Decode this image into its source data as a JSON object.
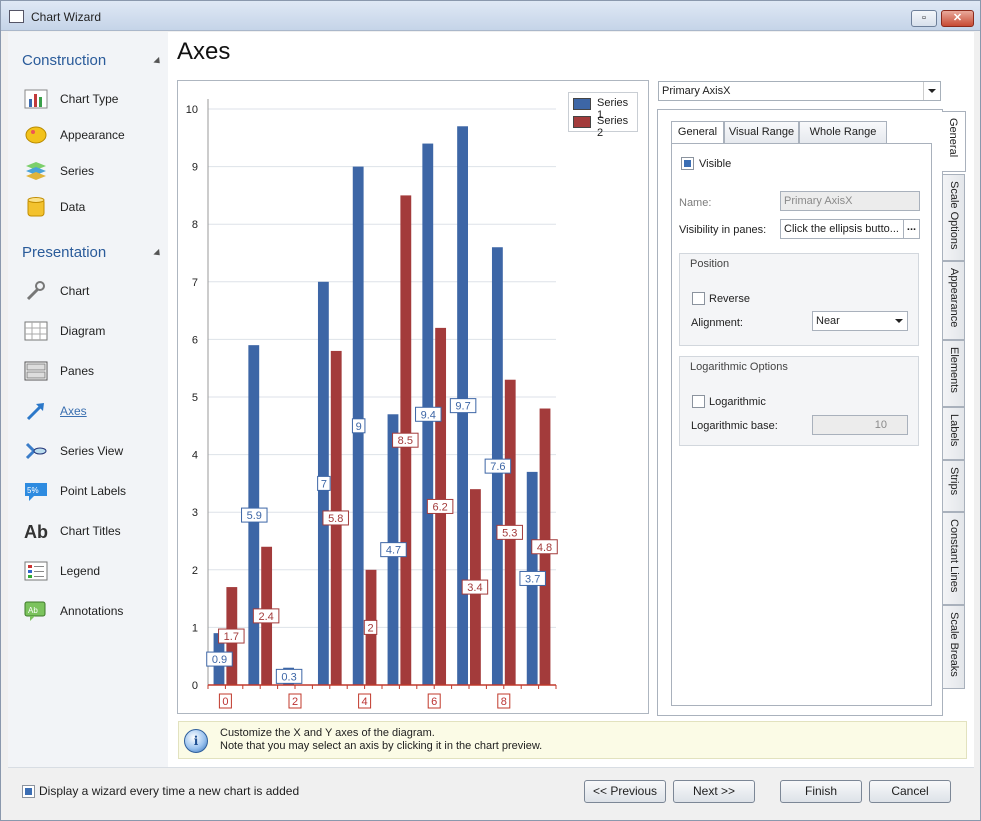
{
  "window": {
    "title": "Chart Wizard"
  },
  "sidebar": {
    "construction_title": "Construction",
    "construction_items": [
      {
        "label": "Chart Type",
        "icon": "bar-chart-icon"
      },
      {
        "label": "Appearance",
        "icon": "palette-icon"
      },
      {
        "label": "Series",
        "icon": "layers-icon"
      },
      {
        "label": "Data",
        "icon": "database-icon"
      }
    ],
    "presentation_title": "Presentation",
    "presentation_items": [
      {
        "label": "Chart",
        "icon": "wrench-icon"
      },
      {
        "label": "Diagram",
        "icon": "grid-icon"
      },
      {
        "label": "Panes",
        "icon": "panes-icon"
      },
      {
        "label": "Axes",
        "icon": "axes-arrow-icon",
        "active": true
      },
      {
        "label": "Series View",
        "icon": "series-view-icon"
      },
      {
        "label": "Point Labels",
        "icon": "point-labels-icon"
      },
      {
        "label": "Chart Titles",
        "icon": "chart-titles-icon"
      },
      {
        "label": "Legend",
        "icon": "legend-icon"
      },
      {
        "label": "Annotations",
        "icon": "annotations-icon"
      }
    ]
  },
  "page": {
    "heading": "Axes"
  },
  "chart_data": {
    "type": "bar",
    "title": "",
    "xlabel": "",
    "ylabel": "",
    "x": [
      0,
      1,
      2,
      3,
      4,
      5,
      6,
      7,
      8,
      9
    ],
    "x_tick_labels": [
      "0",
      "2",
      "4",
      "6",
      "8"
    ],
    "ylim": [
      0,
      10
    ],
    "y_ticks": [
      0,
      1,
      2,
      3,
      4,
      5,
      6,
      7,
      8,
      9,
      10
    ],
    "grid": true,
    "legend_position": "top-right",
    "series": [
      {
        "name": "Series 1",
        "color": "#3d66a6",
        "values": [
          0.9,
          5.9,
          0.3,
          7,
          9,
          4.7,
          9.4,
          9.7,
          7.6,
          3.7
        ],
        "labels": [
          "0.9",
          "5.9",
          "0.3",
          "7",
          "9",
          "4.7",
          "9.4",
          "9.7",
          "7.6",
          "3.7"
        ]
      },
      {
        "name": "Series 2",
        "color": "#a33b3b",
        "values": [
          1.7,
          2.4,
          null,
          5.8,
          2,
          8.5,
          6.2,
          3.4,
          5.3,
          4.8
        ],
        "labels": [
          "1.7",
          "2.4",
          "",
          "5.8",
          "2",
          "8.5",
          "6.2",
          "3.4",
          "5.3",
          "4.8"
        ]
      }
    ]
  },
  "axis_selector": {
    "value": "Primary AxisX"
  },
  "tabs": [
    "General",
    "Visual Range",
    "Whole Range"
  ],
  "general": {
    "visible_label": "Visible",
    "visible_checked": true,
    "name_label": "Name:",
    "name_value": "Primary AxisX",
    "visibility_label": "Visibility in panes:",
    "visibility_value": "Click the ellipsis butto...",
    "ellipsis": "...",
    "position_title": "Position",
    "reverse_label": "Reverse",
    "reverse_checked": false,
    "alignment_label": "Alignment:",
    "alignment_value": "Near",
    "log_title": "Logarithmic Options",
    "log_label": "Logarithmic",
    "log_checked": false,
    "log_base_label": "Logarithmic base:",
    "log_base_value": "10"
  },
  "side_tabs": [
    "General",
    "Scale Options",
    "Appearance",
    "Elements",
    "Labels",
    "Strips",
    "Constant Lines",
    "Scale Breaks"
  ],
  "info": {
    "line1": "Customize the X and Y axes of the diagram.",
    "line2": "Note that you may select an axis by clicking it in the chart preview."
  },
  "footer": {
    "checkbox_label": "Display a wizard every time a new chart is added",
    "checkbox_checked": true,
    "previous": "<< Previous",
    "next": "Next >>",
    "finish": "Finish",
    "cancel": "Cancel"
  }
}
